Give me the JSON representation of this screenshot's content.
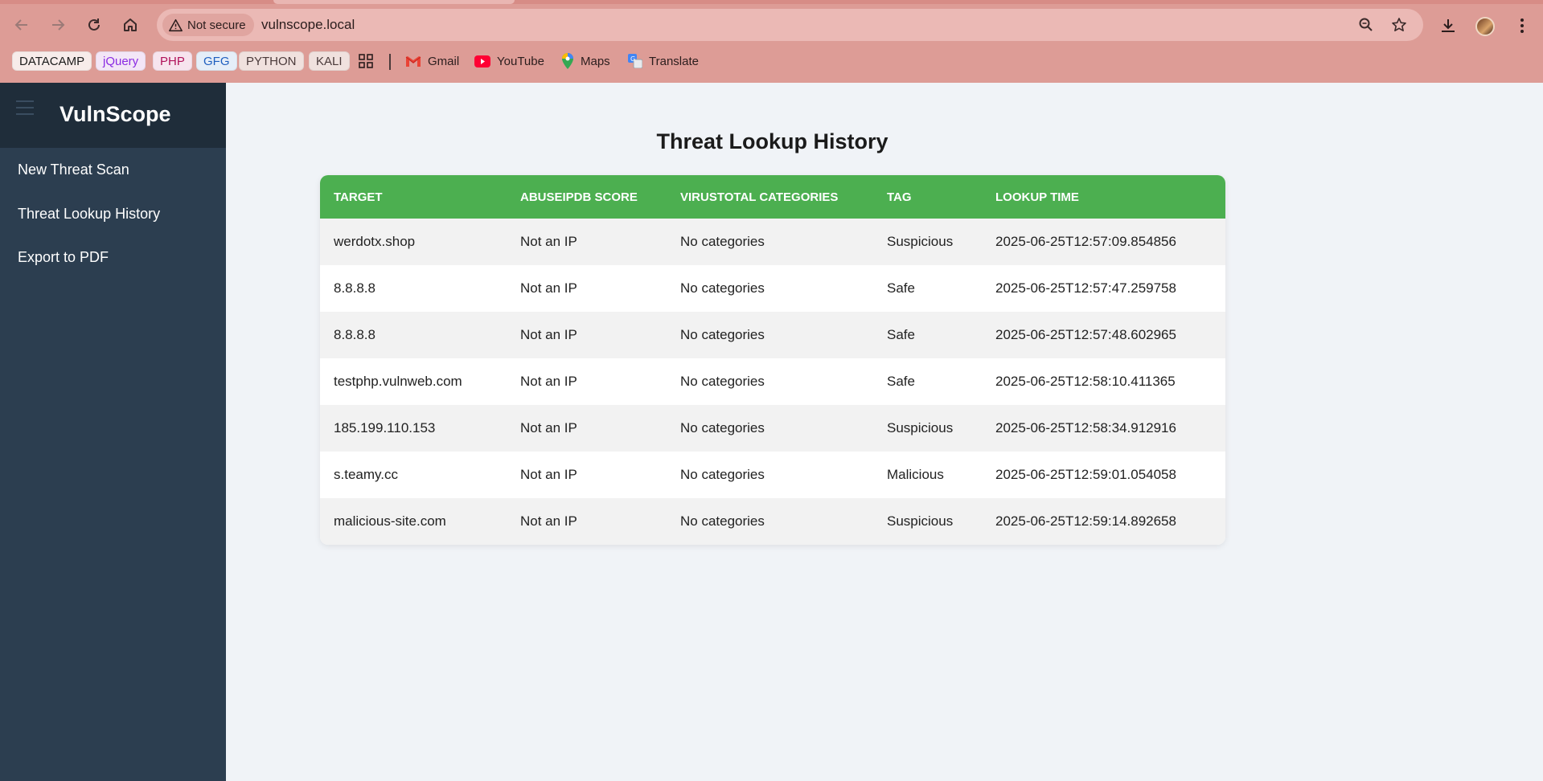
{
  "browser": {
    "security_chip": "Not secure",
    "url": "vulnscope.local",
    "bookmarks_pills": [
      {
        "label": "DATACAMP",
        "bg": "#f7ecea",
        "color": "#1b1b1b"
      },
      {
        "label": "jQuery",
        "bg": "#f3e6f7",
        "color": "#8a2be2"
      },
      {
        "label": "PHP",
        "bg": "#f7e4ee",
        "color": "#b0125a"
      },
      {
        "label": "GFG",
        "bg": "#e5eef8",
        "color": "#1f5fbf"
      },
      {
        "label": "PYTHON",
        "bg": "#f0e1de",
        "color": "#4a3a3a"
      },
      {
        "label": "KALI",
        "bg": "#f0e1de",
        "color": "#4a3a3a"
      }
    ],
    "bookmark_links": {
      "gmail": "Gmail",
      "youtube": "YouTube",
      "maps": "Maps",
      "translate": "Translate"
    }
  },
  "app": {
    "brand": "VulnScope",
    "nav": [
      "New Threat Scan",
      "Threat Lookup History",
      "Export to PDF"
    ],
    "title": "Threat Lookup History",
    "table": {
      "headers": [
        "TARGET",
        "ABUSEIPDB SCORE",
        "VIRUSTOTAL CATEGORIES",
        "TAG",
        "LOOKUP TIME"
      ],
      "rows": [
        [
          "werdotx.shop",
          "Not an IP",
          "No categories",
          "Suspicious",
          "2025-06-25T12:57:09.854856"
        ],
        [
          "8.8.8.8",
          "Not an IP",
          "No categories",
          "Safe",
          "2025-06-25T12:57:47.259758"
        ],
        [
          "8.8.8.8",
          "Not an IP",
          "No categories",
          "Safe",
          "2025-06-25T12:57:48.602965"
        ],
        [
          "testphp.vulnweb.com",
          "Not an IP",
          "No categories",
          "Safe",
          "2025-06-25T12:58:10.411365"
        ],
        [
          "185.199.110.153",
          "Not an IP",
          "No categories",
          "Suspicious",
          "2025-06-25T12:58:34.912916"
        ],
        [
          "s.teamy.cc",
          "Not an IP",
          "No categories",
          "Malicious",
          "2025-06-25T12:59:01.054058"
        ],
        [
          "malicious-site.com",
          "Not an IP",
          "No categories",
          "Suspicious",
          "2025-06-25T12:59:14.892658"
        ]
      ]
    }
  },
  "colors": {
    "sidebar": "#2c3e50",
    "header_green": "#4caf50",
    "chrome": "#dd9c96"
  }
}
